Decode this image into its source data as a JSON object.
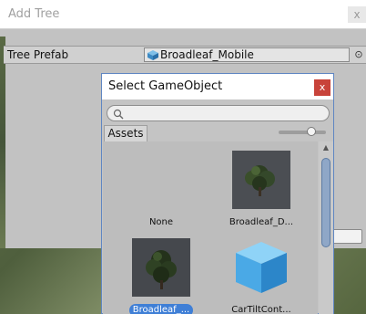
{
  "add_tree": {
    "title": "Add Tree",
    "close_glyph": "x",
    "tree_prefab_label": "Tree Prefab",
    "tree_prefab_value": "Broadleaf_Mobile",
    "picker_glyph": "⊙"
  },
  "select_dialog": {
    "title": "Select GameObject",
    "close_glyph": "x",
    "search_placeholder": "",
    "tabs": [
      {
        "label": "Assets",
        "active": true
      }
    ],
    "items": [
      {
        "label": "None",
        "icon": "none",
        "selected": false
      },
      {
        "label": "Broadleaf_D...",
        "icon": "tree-prefab-thumbnail",
        "selected": false
      },
      {
        "label": "Broadleaf_...",
        "icon": "tree-prefab-thumbnail",
        "selected": true
      },
      {
        "label": "CarTiltCont...",
        "icon": "cube-prefab-icon",
        "selected": false
      }
    ]
  },
  "colors": {
    "selection": "#3f7fd6",
    "close_button": "#c8433a",
    "cube": "#4aa9e6"
  }
}
